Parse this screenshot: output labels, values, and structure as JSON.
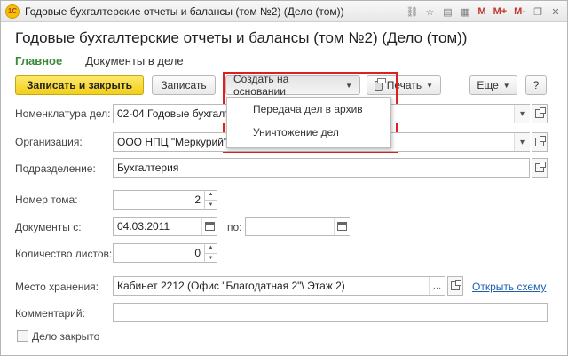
{
  "window": {
    "title": "Годовые бухгалтерские отчеты и балансы (том №2) (Дело (том))",
    "logo": "1С",
    "controls": [
      "M",
      "M+",
      "M-"
    ]
  },
  "background_title": "Дело (том)",
  "heading": "Годовые бухгалтерские отчеты и балансы (том №2) (Дело (том))",
  "tabs": [
    {
      "label": "Главное",
      "active": true
    },
    {
      "label": "Документы в деле",
      "active": false
    }
  ],
  "toolbar": {
    "save_close": "Записать и закрыть",
    "save": "Записать",
    "create_based": "Создать на основании",
    "print": "Печать",
    "more": "Еще",
    "help": "?"
  },
  "dropdown_menu": {
    "items": [
      "Передача дел в архив",
      "Уничтожение дел"
    ]
  },
  "form": {
    "nomenclature": {
      "label": "Номенклатура дел:",
      "value": "02-04 Годовые бухгалт"
    },
    "organization": {
      "label": "Организация:",
      "value": "ООО НПЦ \"Меркурий\""
    },
    "department": {
      "label": "Подразделение:",
      "value": "Бухгалтерия"
    },
    "volume_number": {
      "label": "Номер тома:",
      "value": "2"
    },
    "documents_from": {
      "label": "Документы с:",
      "value": "04.03.2011",
      "to_label": "по:",
      "to_value": ""
    },
    "sheet_count": {
      "label": "Количество листов:",
      "value": "0"
    },
    "storage": {
      "label": "Место хранения:",
      "value": "Кабинет 2212 (Офис \"Благодатная 2\"\\ Этаж 2)",
      "link": "Открыть схему"
    },
    "comment": {
      "label": "Комментарий:",
      "value": ""
    },
    "closed": {
      "label": "Дело закрыто",
      "checked": false
    }
  },
  "colors": {
    "accent_green": "#3b8a3b",
    "primary_button": "#f2cf1a",
    "highlight_frame": "#e02020",
    "link": "#1f5fb0"
  }
}
